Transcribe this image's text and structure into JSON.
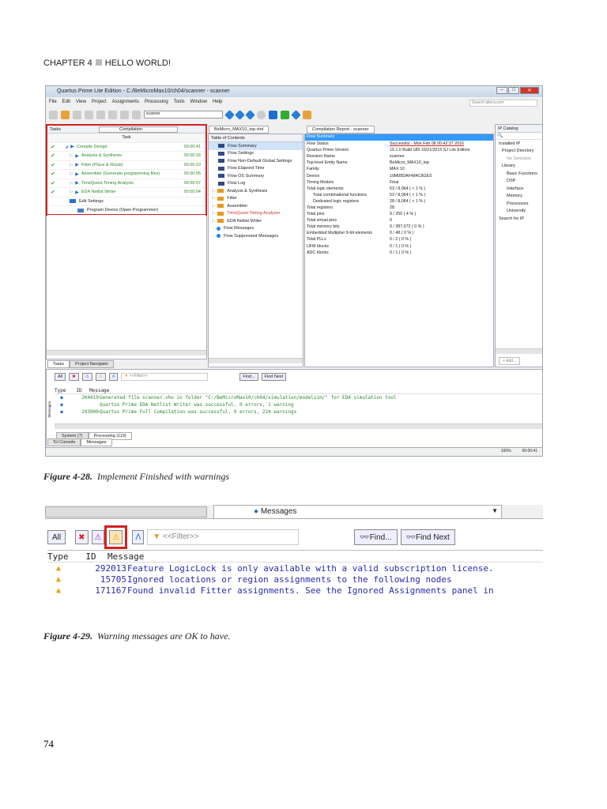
{
  "chapter": {
    "label": "CHAPTER 4",
    "title": "HELLO WORLD!"
  },
  "fig1": {
    "window_title": "Quartus Prime Lite Edition - C:/BeMicroMax10/ch04/scanner - scanner",
    "menu": [
      "File",
      "Edit",
      "View",
      "Project",
      "Assignments",
      "Processing",
      "Tools",
      "Window",
      "Help"
    ],
    "search_placeholder": "Search altera.com",
    "project_combo": "scanner",
    "tasks": {
      "title": "Tasks",
      "flow": "Compilation",
      "col_task": "Task",
      "rows": [
        {
          "name": "Compile Design",
          "time": "00:00:41"
        },
        {
          "name": "Analysis & Synthesis",
          "time": "00:00:16"
        },
        {
          "name": "Fitter (Place & Route)",
          "time": "00:00:10"
        },
        {
          "name": "Assembler (Generate programming files)",
          "time": "00:00:05"
        },
        {
          "name": "TimeQuest Timing Analysis",
          "time": "00:00:07"
        },
        {
          "name": "EDA Netlist Writer",
          "time": "00:00:04"
        }
      ],
      "extra": [
        "Edit Settings",
        "Program Device (Open Programmer)"
      ],
      "tabs": [
        "Tasks",
        "Project Navigator"
      ]
    },
    "file_tab": "BeMicro_MAX10_top.vhd",
    "report_tab": "Compilation Report - scanner",
    "toc": {
      "title": "Table of Contents",
      "items": [
        "Flow Summary",
        "Flow Settings",
        "Flow Non-Default Global Settings",
        "Flow Elapsed Time",
        "Flow OS Summary",
        "Flow Log",
        "Analysis & Synthesis",
        "Fitter",
        "Assembler",
        "TimeQuest Timing Analyzer",
        "EDA Netlist Writer",
        "Flow Messages",
        "Flow Suppressed Messages"
      ]
    },
    "summary": {
      "title": "Flow Summary",
      "rows": [
        [
          "Flow Status",
          "Successful - Mon Feb 08 00:42:37 2016"
        ],
        [
          "Quartus Prime Version",
          "15.1.0 Build 185 10/21/2015 SJ Lite Edition"
        ],
        [
          "Revision Name",
          "scanner"
        ],
        [
          "Top-level Entity Name",
          "BeMicro_MAX10_top"
        ],
        [
          "Family",
          "MAX 10"
        ],
        [
          "Device",
          "10M08DAF484C8GES"
        ],
        [
          "Timing Models",
          "Final"
        ],
        [
          "Total logic elements",
          "53 / 8,064 ( < 1 % )"
        ],
        [
          "Total combinational functions",
          "53 / 8,064 ( < 1 % )"
        ],
        [
          "Dedicated logic registers",
          "28 / 8,064 ( < 1 % )"
        ],
        [
          "Total registers",
          "28"
        ],
        [
          "Total pins",
          "9 / 250 ( 4 % )"
        ],
        [
          "Total virtual pins",
          "0"
        ],
        [
          "Total memory bits",
          "0 / 387,072 ( 0 % )"
        ],
        [
          "Embedded Multiplier 9-bit elements",
          "0 / 48 ( 0 % )"
        ],
        [
          "Total PLLs",
          "0 / 2 ( 0 % )"
        ],
        [
          "UFM blocks",
          "0 / 1 ( 0 % )"
        ],
        [
          "ADC blocks",
          "0 / 1 ( 0 % )"
        ]
      ]
    },
    "ip": {
      "title": "IP Catalog",
      "items": [
        "Installed IP",
        "Project Directory",
        "No Selection",
        "Library",
        "Basic Functions",
        "DSP",
        "Interface",
        "Memory",
        "Processors",
        "University",
        "Search for IP"
      ],
      "add": "+ Add..."
    },
    "messages": {
      "all": "All",
      "filter": "<<Filter>>",
      "find": "Find...",
      "find_next": "Find Next",
      "cols": [
        "Type",
        "ID",
        "Message"
      ],
      "rows": [
        {
          "id": "204019",
          "text": "Generated file scanner.vho in folder \"C:/BeMicroMax10/ch04/simulation/modelsim/\" for EDA simulation tool"
        },
        {
          "id": "",
          "text": "Quartus Prime EDA Netlist Writer was successful. 0 errors, 1 warning"
        },
        {
          "id": "293000",
          "text": "Quartus Prime Full Compilation was successful. 0 errors, 224 warnings"
        }
      ],
      "tabs": [
        "System (7)",
        "Processing (119)"
      ],
      "bottom_tabs": [
        "Tcl Console",
        "Messages"
      ],
      "side_label": "Messages"
    },
    "status": {
      "zoom": "100%",
      "time": "00:00:41"
    }
  },
  "caption1": {
    "label": "Figure 4-28.",
    "text": "Implement Finished with warnings"
  },
  "fig2": {
    "dropdown": "Messages",
    "all": "All",
    "filter": "<<Filter>>",
    "find": "Find...",
    "find_next": "Find Next",
    "cols": [
      "Type",
      "ID",
      "Message"
    ],
    "rows": [
      {
        "id": "292013",
        "text": "Feature LogicLock is only available with a valid subscription license."
      },
      {
        "id": "15705",
        "text": "Ignored locations or region assignments to the following nodes"
      },
      {
        "id": "171167",
        "text": "Found invalid Fitter assignments. See the Ignored Assignments panel in"
      }
    ]
  },
  "caption2": {
    "label": "Figure 4-29.",
    "text": "Warning messages are OK to have."
  },
  "page_number": "74",
  "colors": {
    "highlight_red": "#d32020",
    "success_green": "#2c8a2c",
    "selection_blue": "#3399ff"
  }
}
